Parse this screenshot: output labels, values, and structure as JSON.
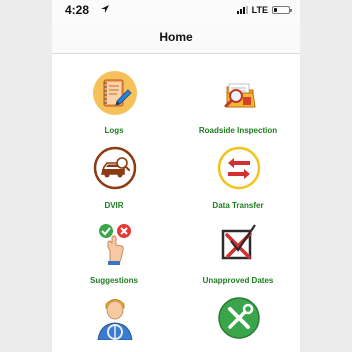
{
  "status_bar": {
    "time": "4:28",
    "network": "LTE"
  },
  "header": {
    "title": "Home"
  },
  "menu": {
    "items": [
      {
        "label": "Logs",
        "icon": "notebook-pencil-icon"
      },
      {
        "label": "Roadside Inspection",
        "icon": "folder-magnifier-icon"
      },
      {
        "label": "DVIR",
        "icon": "car-inspection-icon"
      },
      {
        "label": "Data Transfer",
        "icon": "transfer-arrows-icon"
      },
      {
        "label": "Suggestions",
        "icon": "thumbs-choice-icon"
      },
      {
        "label": "Unapproved Dates",
        "icon": "checkbox-x-icon"
      },
      {
        "label": "",
        "icon": "driver-avatar-icon"
      },
      {
        "label": "",
        "icon": "settings-tools-icon"
      }
    ]
  },
  "colors": {
    "label_green": "#1e7d1e",
    "accent_red": "#d32f2f",
    "accent_brown": "#8b3a12"
  }
}
